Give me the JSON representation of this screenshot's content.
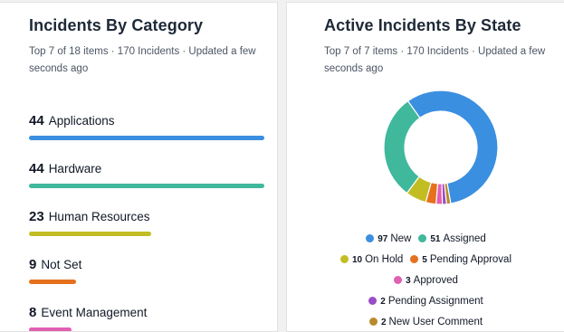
{
  "left_card": {
    "title": "Incidents By Category",
    "subtitle": "Top 7 of 18 items · 170 Incidents · Updated a few seconds ago",
    "items": [
      {
        "count": "44",
        "label": "Applications",
        "color": "#3b8fe0",
        "fraction": 1.0
      },
      {
        "count": "44",
        "label": "Hardware",
        "color": "#3fb89c",
        "fraction": 1.0
      },
      {
        "count": "23",
        "label": "Human Resources",
        "color": "#c3bd24",
        "fraction": 0.52
      },
      {
        "count": "9",
        "label": "Not Set",
        "color": "#e5701e",
        "fraction": 0.2
      },
      {
        "count": "8",
        "label": "Event Management",
        "color": "#e25fb3",
        "fraction": 0.18
      }
    ]
  },
  "right_card": {
    "title": "Active Incidents By State",
    "subtitle": "Top 7 of 7 items · 170 Incidents · Updated a few seconds ago",
    "legend_rows": [
      [
        {
          "count": "97",
          "label": "New",
          "color": "#3b8fe0"
        },
        {
          "count": "51",
          "label": "Assigned",
          "color": "#3fb89c"
        }
      ],
      [
        {
          "count": "10",
          "label": "On Hold",
          "color": "#c3bd24"
        },
        {
          "count": "5",
          "label": "Pending Approval",
          "color": "#e5701e"
        }
      ],
      [
        {
          "count": "3",
          "label": "Approved",
          "color": "#e25fb3"
        }
      ],
      [
        {
          "count": "2",
          "label": "Pending Assignment",
          "color": "#9a4dc8"
        }
      ],
      [
        {
          "count": "2",
          "label": "New User Comment",
          "color": "#b88a2d"
        }
      ]
    ]
  },
  "chart_data": {
    "type": "pie",
    "donut": true,
    "categories": [
      "New",
      "Assigned",
      "On Hold",
      "Pending Approval",
      "Approved",
      "Pending Assignment",
      "New User Comment"
    ],
    "values": [
      97,
      51,
      10,
      5,
      3,
      2,
      2
    ],
    "colors": [
      "#3b8fe0",
      "#3fb89c",
      "#c3bd24",
      "#e5701e",
      "#e25fb3",
      "#9a4dc8",
      "#b88a2d"
    ]
  }
}
